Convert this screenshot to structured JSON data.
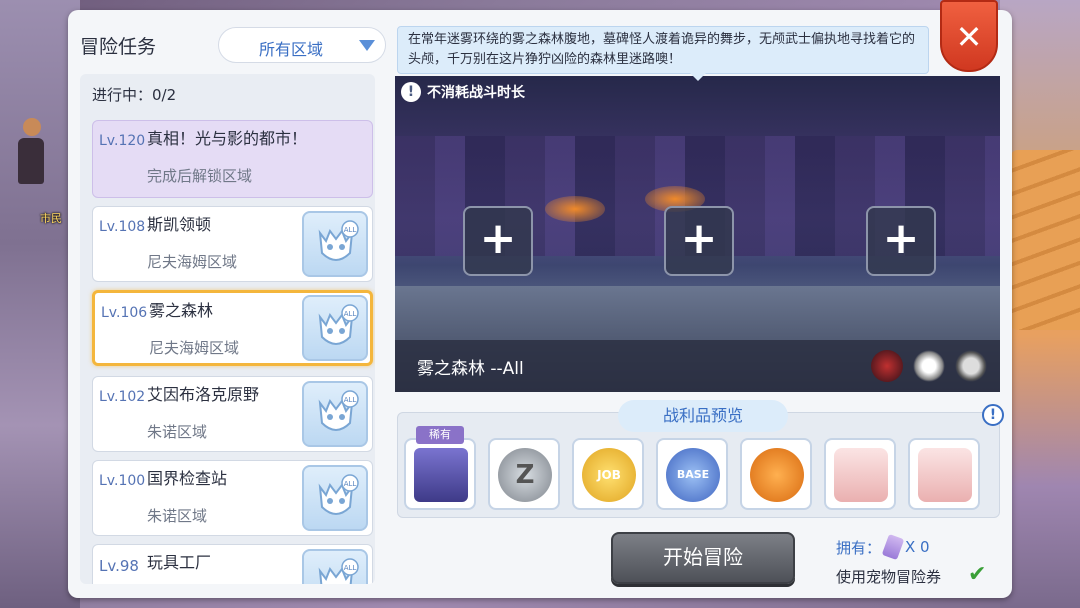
{
  "header": {
    "title": "冒险任务",
    "region_filter": "所有区域",
    "close_label": "✕"
  },
  "quest_list": {
    "progress": "进行中：0/2",
    "items": [
      {
        "level": "Lv.120",
        "name": "真相！光与影的都市！",
        "area": "完成后解锁区域",
        "state": "locked"
      },
      {
        "level": "Lv.108",
        "name": "斯凯领顿",
        "area": "尼夫海姆区域",
        "state": "normal",
        "difficulty": "ALL"
      },
      {
        "level": "Lv.106",
        "name": "雾之森林",
        "area": "尼夫海姆区域",
        "state": "selected",
        "difficulty": "ALL"
      },
      {
        "level": "Lv.102",
        "name": "艾因布洛克原野",
        "area": "朱诺区域",
        "state": "normal",
        "difficulty": "ALL"
      },
      {
        "level": "Lv.100",
        "name": "国界检查站",
        "area": "朱诺区域",
        "state": "normal",
        "difficulty": "ALL"
      },
      {
        "level": "Lv.98",
        "name": "玩具工厂",
        "area": "",
        "state": "normal",
        "difficulty": "ALL"
      }
    ]
  },
  "description": "在常年迷雾环绕的雾之森林腹地，墓碑怪人渡着诡异的舞步，无颅武士偏执地寻找着它的头颅，千万别在这片狰狞凶险的森林里迷路噢！",
  "scene": {
    "notice": "不消耗战斗时长",
    "slots": [
      "+",
      "+",
      "+"
    ],
    "title": "雾之森林 --All",
    "icons": [
      "dark-orb-icon",
      "eye-emblem-icon",
      "skull-badge-icon"
    ]
  },
  "loot": {
    "title": "战利品预览",
    "rare_label": "稀有",
    "items": [
      {
        "name": "treasure-chest-icon",
        "color": "#5b58b8"
      },
      {
        "name": "zeny-coin-icon",
        "color": "#9aa0a8",
        "label": "Z"
      },
      {
        "name": "job-exp-icon",
        "color": "#f2c23a",
        "label": "JOB"
      },
      {
        "name": "base-exp-icon",
        "color": "#5a84d8",
        "label": "BASE"
      },
      {
        "name": "pumpkin-icon",
        "color": "#f08a24"
      },
      {
        "name": "card-scroll-icon",
        "color": "#f2c6c6"
      },
      {
        "name": "card-scroll-icon",
        "color": "#f2c6c6"
      }
    ]
  },
  "footer": {
    "start_button": "开始冒险",
    "own_label": "拥有：",
    "own_count": "X 0",
    "use_pet_label": "使用宠物冒险券",
    "check_mark": "✔"
  },
  "background": {
    "npc_label": "市民"
  },
  "colors": {
    "accent_blue": "#3a6fc4",
    "selected_border": "#f4b63c",
    "close_red": "#e04a2c"
  }
}
